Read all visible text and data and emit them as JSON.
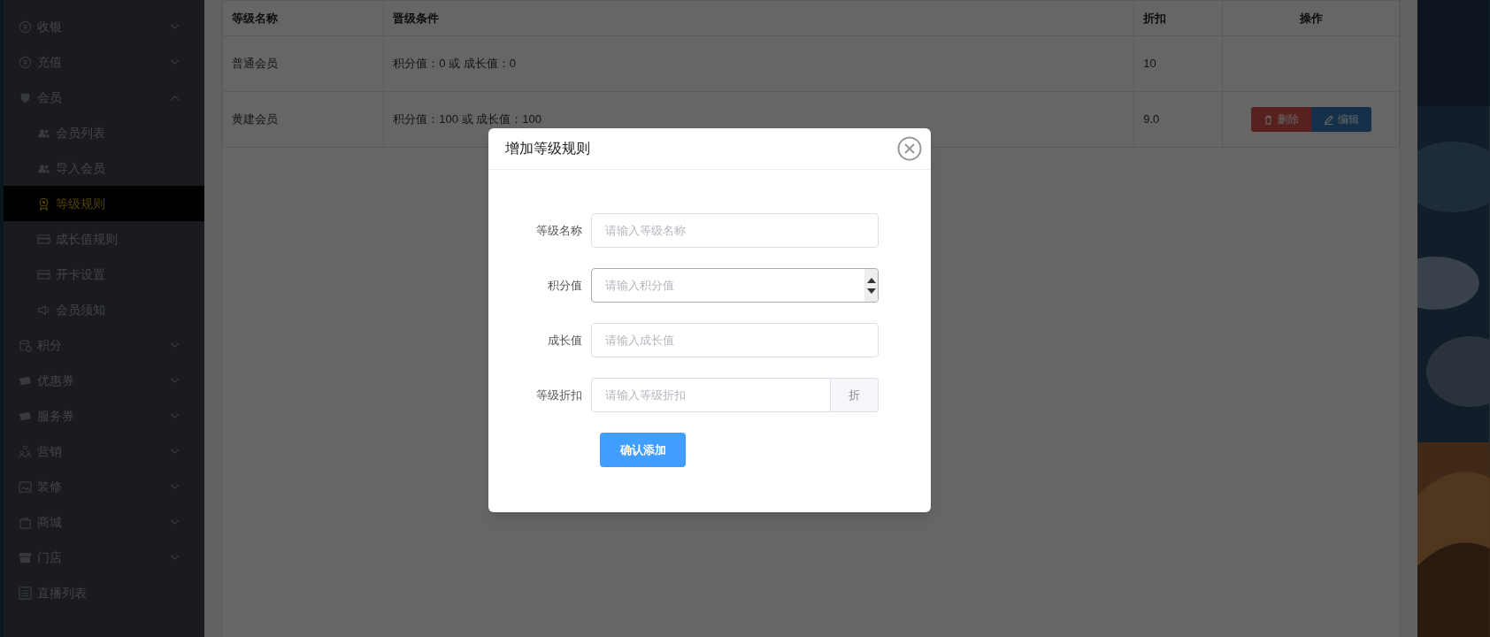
{
  "sidebar": {
    "items": [
      {
        "label": "收银",
        "kind": "yen",
        "expanded": false,
        "selected": false
      },
      {
        "label": "充值",
        "kind": "yen",
        "expanded": false,
        "selected": false
      },
      {
        "label": "会员",
        "kind": "badge",
        "expanded": true,
        "selected": false,
        "children": [
          {
            "label": "会员列表",
            "kind": "users",
            "selected": false
          },
          {
            "label": "导入会员",
            "kind": "users",
            "selected": false
          },
          {
            "label": "等级规则",
            "kind": "medal",
            "selected": true
          },
          {
            "label": "成长值规则",
            "kind": "card",
            "selected": false
          },
          {
            "label": "开卡设置",
            "kind": "card",
            "selected": false
          },
          {
            "label": "会员须知",
            "kind": "speaker",
            "selected": false
          }
        ]
      },
      {
        "label": "积分",
        "kind": "coins",
        "expanded": false,
        "selected": false
      },
      {
        "label": "优惠券",
        "kind": "ticket",
        "expanded": false,
        "selected": false
      },
      {
        "label": "服务券",
        "kind": "ticket",
        "expanded": false,
        "selected": false
      },
      {
        "label": "营销",
        "kind": "people",
        "expanded": false,
        "selected": false
      },
      {
        "label": "装修",
        "kind": "picture",
        "expanded": false,
        "selected": false
      },
      {
        "label": "商城",
        "kind": "bag",
        "expanded": false,
        "selected": false
      },
      {
        "label": "门店",
        "kind": "store",
        "expanded": false,
        "selected": false
      },
      {
        "label": "直播列表",
        "kind": "list"
      }
    ]
  },
  "table": {
    "columns": [
      "等级名称",
      "晋级条件",
      "折扣",
      "操作"
    ],
    "rows": [
      {
        "name": "普通会员",
        "condition": "积分值：0 或 成长值：0",
        "discount": "10"
      },
      {
        "name": "黄建会员",
        "condition": "积分值：100 或 成长值：100",
        "discount": "9.0",
        "actions": [
          "删除",
          "编辑"
        ]
      }
    ]
  },
  "dialog": {
    "title": "增加等级规则",
    "fields": [
      {
        "label": "等级名称",
        "placeholder": "请输入等级名称",
        "kind": "text"
      },
      {
        "label": "积分值",
        "placeholder": "请输入积分值",
        "kind": "number"
      },
      {
        "label": "成长值",
        "placeholder": "请输入成长值",
        "kind": "text"
      },
      {
        "label": "等级折扣",
        "placeholder": "请输入等级折扣",
        "kind": "suffix",
        "suffix": "折"
      }
    ],
    "submit": "确认添加"
  }
}
